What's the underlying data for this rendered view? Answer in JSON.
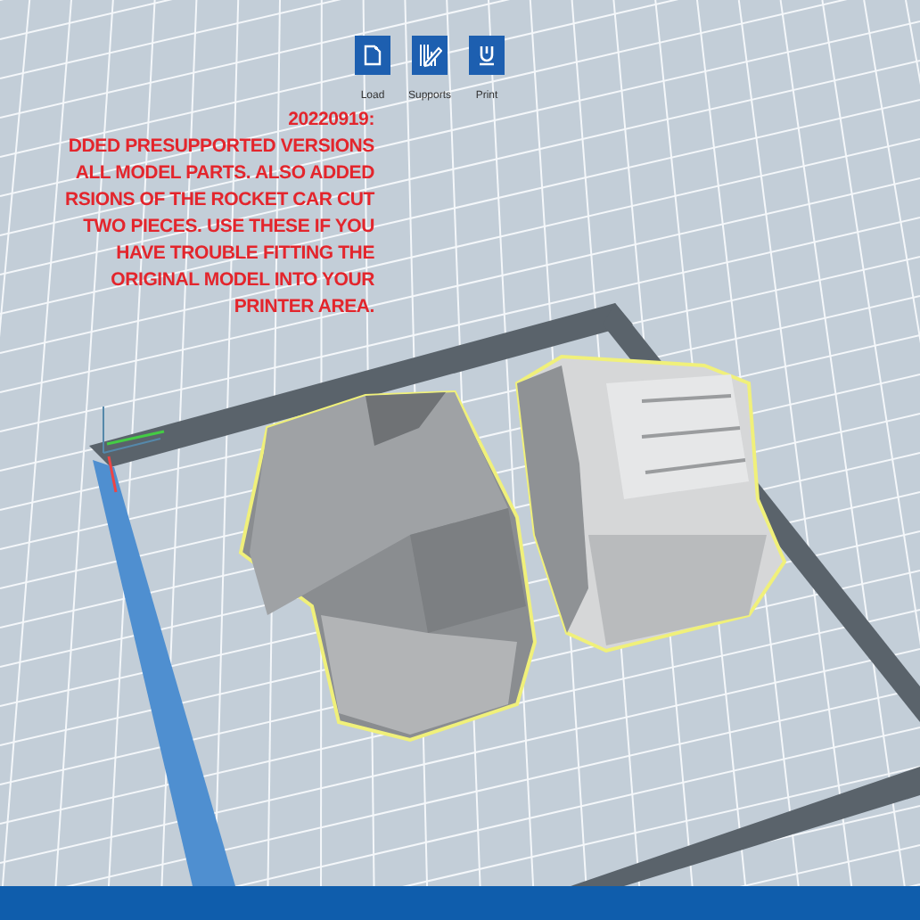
{
  "toolbar": [
    {
      "kind": "load",
      "label": "Load"
    },
    {
      "kind": "supports",
      "label": "Supports"
    },
    {
      "kind": "print",
      "label": "Print"
    }
  ],
  "note": {
    "lines": [
      "20220919:",
      "DDED PRESUPPORTED VERSIONS",
      "ALL MODEL PARTS. ALSO ADDED",
      "RSIONS OF THE ROCKET CAR CUT",
      "TWO PIECES. USE THESE IF YOU",
      "HAVE TROUBLE FITTING THE",
      "ORIGINAL MODEL INTO YOUR",
      "PRINTER AREA."
    ]
  }
}
